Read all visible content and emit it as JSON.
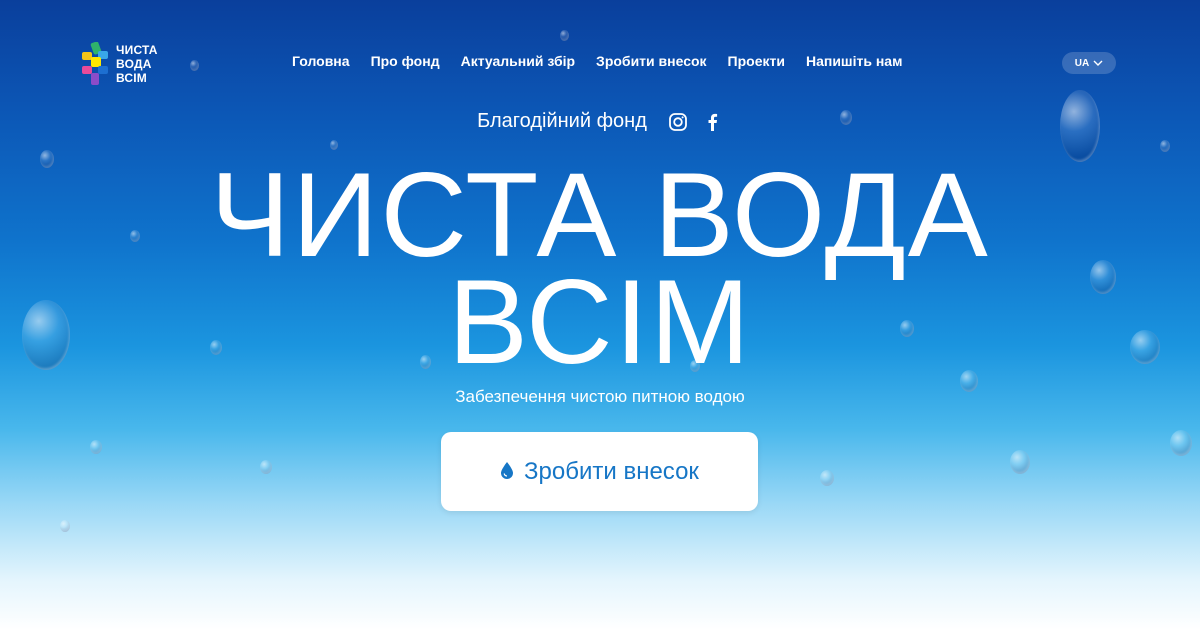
{
  "logo": {
    "lines": [
      "ЧИСТА",
      "ВОДА",
      "ВСІМ"
    ]
  },
  "nav": {
    "items": [
      {
        "label": "Головна"
      },
      {
        "label": "Про фонд"
      },
      {
        "label": "Актуальний збір"
      },
      {
        "label": "Зробити внесок"
      },
      {
        "label": "Проекти"
      },
      {
        "label": "Напишіть нам"
      }
    ]
  },
  "language": {
    "selected": "UA",
    "icon": "chevron-down-icon"
  },
  "hero": {
    "fund_label": "Благодійний фонд",
    "social": [
      {
        "icon": "instagram-icon"
      },
      {
        "icon": "facebook-icon"
      }
    ],
    "headline_line1": "ЧИСТА ВОДА",
    "headline_line2": "ВСІМ",
    "tagline": "Забезпечення чистою питною водою",
    "cta_label": "Зробити внесок",
    "cta_icon": "water-drop-icon"
  },
  "colors": {
    "accent": "#1676c6",
    "background_top": "#0a3f9c",
    "background_bottom": "#ffffff"
  }
}
